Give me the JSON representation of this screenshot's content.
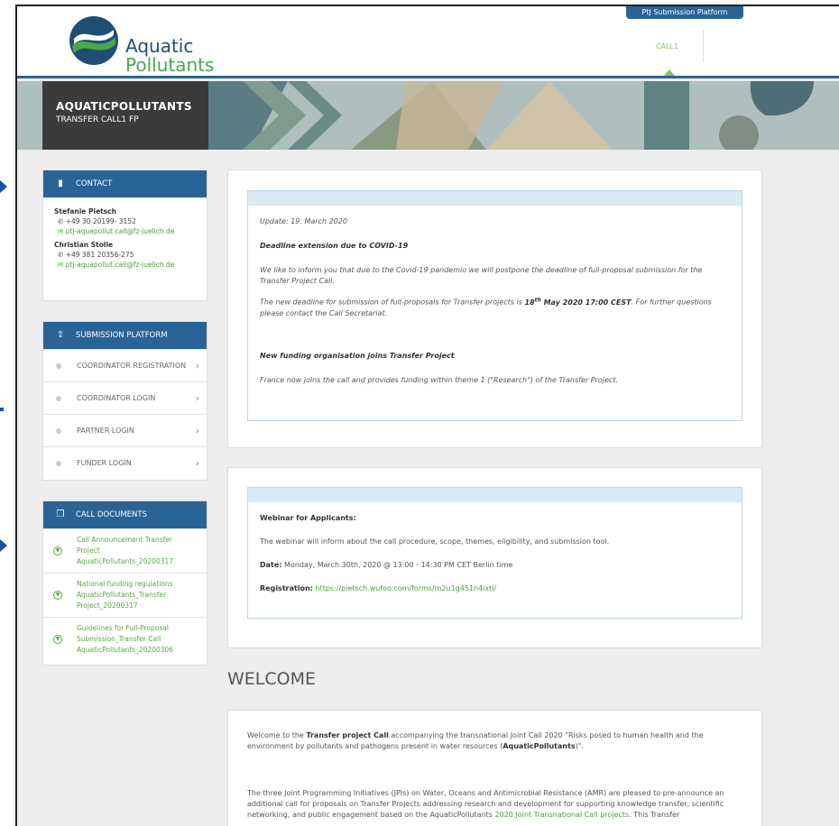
{
  "header": {
    "logo_line1": "Aquatic",
    "logo_line2": "Pollutants",
    "platform_button": "PtJ Submission Platform",
    "nav_call": "CALL1"
  },
  "banner": {
    "title": "AQUATICPOLLUTANTS",
    "subtitle": "TRANSFER CALL1 FP"
  },
  "contact": {
    "heading": "CONTACT",
    "people": [
      {
        "name": "Stefanie Pietsch",
        "phone": "+49 30 20199- 3152",
        "email": "ptj-aquapollut.call@fz-juelich.de"
      },
      {
        "name": "Christian Stolle",
        "phone": "+49 381 20356-275",
        "email": "ptj-aquapollut.call@fz-juelich.de"
      }
    ]
  },
  "submission": {
    "heading": "SUBMISSION PLATFORM",
    "items": [
      "COORDINATOR REGISTRATION",
      "COORDINATOR LOGIN",
      "PARTNER LOGIN",
      "FUNDER LOGIN"
    ]
  },
  "documents": {
    "heading": "CALL DOCUMENTS",
    "items": [
      "Call Announcement Transfer Project AquaticPollutants_20200317",
      "National funding regulations AquaticPollutants_Transfer Project_20200317",
      "Guidelines for Full-Proposal Submission_Transfer Call AquaticPollutants_20200306"
    ]
  },
  "update": {
    "date": "Update: 19. March 2020",
    "title1": "Deadline extension due to COVID-19",
    "p1": "We like to inform you that due to the Covid-19 pandemio we will postpone the deadline of full-proposal submission for the Transfer Project Call.",
    "p2a": "The new deadline for submission of full-proposals for Transfer projects is ",
    "p2b": "18",
    "p2c": "th",
    "p2d": " May 2020 17:00 CEST",
    "p2e": ". For further questions please contact the Call Secretariat.",
    "title2": "New funding organisation joins Transfer Project",
    "p3": "France now joins the call and provides funding within theme 1 (\"Research\") of the Transfer Project."
  },
  "webinar": {
    "title": "Webinar for Applicants:",
    "text": "The webinar will inform about the call procedure, scope, themes, eligibility, and submission tool.",
    "date_label": "Date:",
    "date_value": " Monday, March 30th, 2020 @ 13:00 - 14:30 PM CET Berlin time",
    "reg_label": "Registration:",
    "reg_link": "https://pietsch.wufoo.com/forms/m2u1g451n4ixtl/"
  },
  "welcome": {
    "heading": "WELCOME",
    "p1a": "Welcome to the ",
    "p1b": "Transfer project Call",
    "p1c": " accompanying the transnational Joint Call 2020 \"Risks posed to human health and the environment by pollutants and pathogens present in water resources (",
    "p1d": "AquaticPollutants",
    "p1e": ")\".",
    "p2a": "The three Joint Programming Initiatives (JPIs) on Water, Oceans and Antimicrobial Resistance (AMR) are pleased to pre-announce an additional call for proposals on Transfer Projects addressing research and development for supporting knowledge transfer, scientific networking, and public engagement based on the AquaticPollutants ",
    "p2b": "2020 Joint Transnational Call projects",
    "p2c": ". This Transfer"
  },
  "colors": {
    "primary": "#2a6496",
    "accent_green": "#4a9e3c",
    "banner_dark": "#3b3b3b"
  }
}
